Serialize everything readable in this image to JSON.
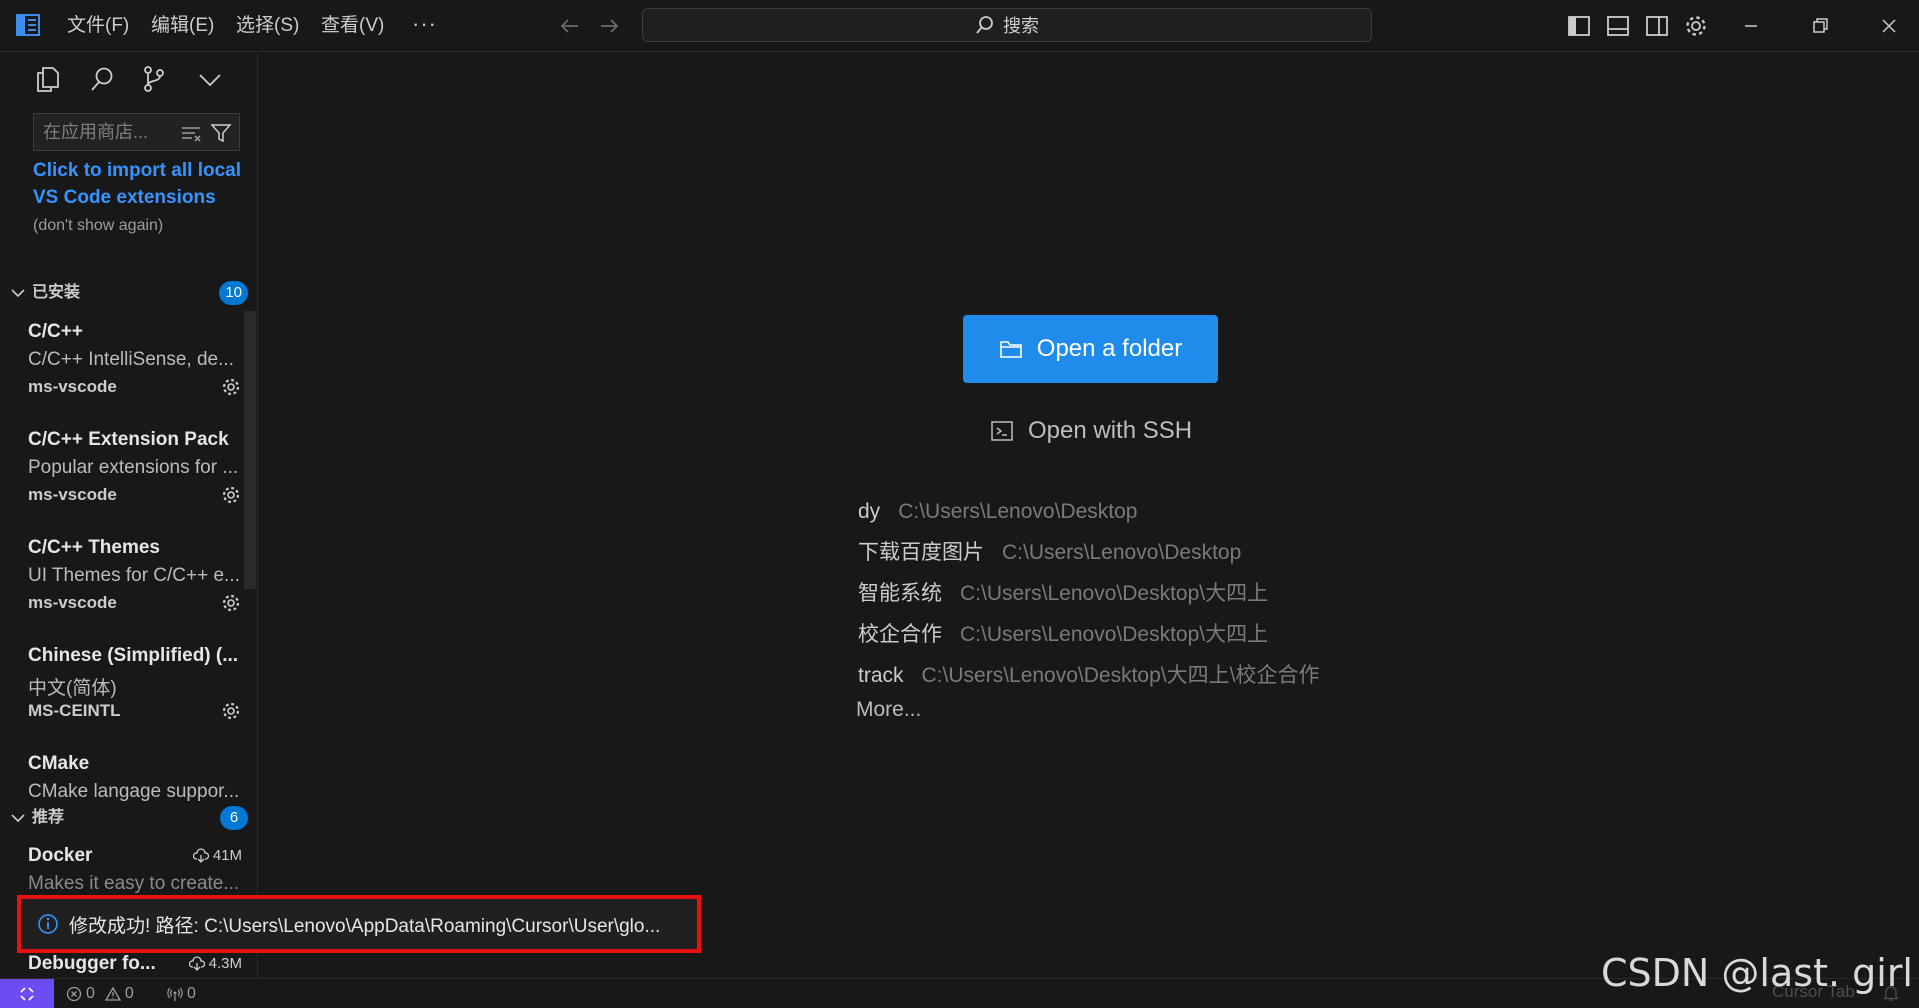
{
  "titlebar": {
    "menus": [
      "文件(F)",
      "编辑(E)",
      "选择(S)",
      "查看(V)"
    ],
    "more": "···",
    "search_label": "搜索"
  },
  "sidebar": {
    "search_placeholder": "在应用商店...",
    "import": {
      "link": "Click to import all local VS Code extensions",
      "hint": "(don't show again)"
    },
    "installed": {
      "label": "已安装",
      "count": "10",
      "items": [
        {
          "name": "C/C++",
          "desc": "C/C++ IntelliSense, de...",
          "publisher": "ms-vscode"
        },
        {
          "name": "C/C++ Extension Pack",
          "desc": "Popular extensions for ...",
          "publisher": "ms-vscode"
        },
        {
          "name": "C/C++ Themes",
          "desc": "UI Themes for C/C++ e...",
          "publisher": "ms-vscode"
        },
        {
          "name": "Chinese (Simplified) (...",
          "desc": "中文(简体)",
          "publisher": "MS-CEINTL"
        },
        {
          "name": "CMake",
          "desc": "CMake langage suppor...",
          "publisher": ""
        }
      ]
    },
    "recommended": {
      "label": "推荐",
      "count": "6",
      "items": [
        {
          "name": "Docker",
          "desc": "Makes it easy to create...",
          "downloads": "41M"
        },
        {
          "name": "Debugger fo...",
          "desc": "",
          "downloads": "4.3M"
        }
      ]
    }
  },
  "main": {
    "open_folder": "Open a folder",
    "open_ssh": "Open with SSH",
    "recent": [
      {
        "name": "dy",
        "path": "C:\\Users\\Lenovo\\Desktop"
      },
      {
        "name": "下载百度图片",
        "path": "C:\\Users\\Lenovo\\Desktop"
      },
      {
        "name": "智能系统",
        "path": "C:\\Users\\Lenovo\\Desktop\\大四上"
      },
      {
        "name": "校企合作",
        "path": "C:\\Users\\Lenovo\\Desktop\\大四上"
      },
      {
        "name": "track",
        "path": "C:\\Users\\Lenovo\\Desktop\\大四上\\校企合作"
      }
    ],
    "more": "More..."
  },
  "toast": {
    "message": "修改成功!  路径: C:\\Users\\Lenovo\\AppData\\Roaming\\Cursor\\User\\glo..."
  },
  "statusbar": {
    "errors": "0",
    "warnings": "0",
    "ports": "0",
    "cursor_tab": "Cursor Tab"
  },
  "watermark": "CSDN @last. girl",
  "colors": {
    "accent": "#1f8ceb",
    "badge": "#0078d4",
    "link": "#3794ff",
    "remote": "#6d4df2",
    "toast_border": "#e81010"
  }
}
